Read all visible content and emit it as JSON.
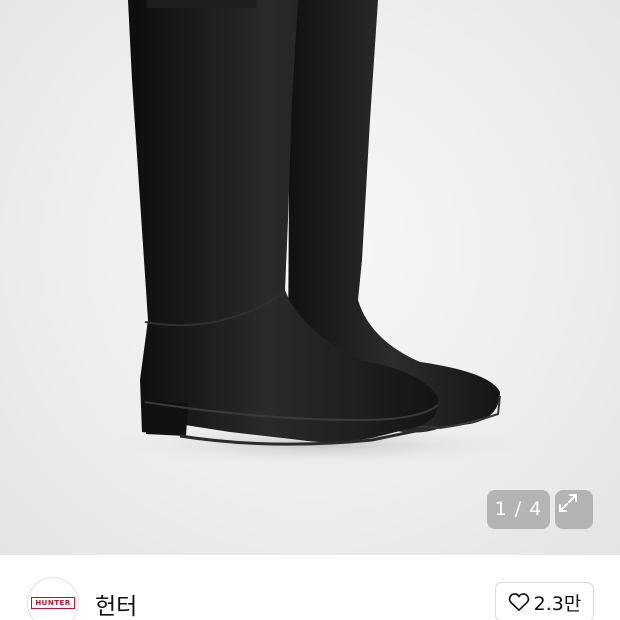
{
  "product": {
    "image_alt": "black tall rain boots",
    "image_counter": "1 / 4"
  },
  "brand": {
    "logo_text": "HUNTER",
    "name": "헌터",
    "like_count": "2.3만"
  },
  "icons": {
    "expand": "expand-arrows-icon",
    "like": "heart-outline-icon"
  },
  "colors": {
    "logo_red": "#c8102e",
    "badge_bg": "#a0a0a0"
  }
}
